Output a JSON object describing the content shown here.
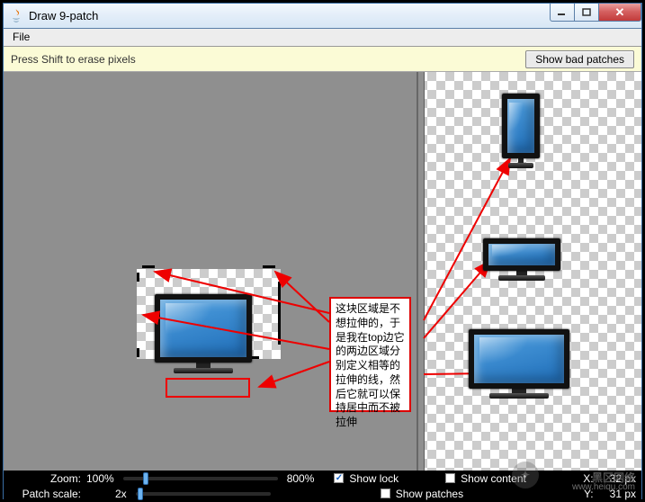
{
  "window": {
    "title": "Draw 9-patch",
    "icons": {
      "app": "java-icon",
      "min": "minimize-icon",
      "max": "maximize-icon",
      "close": "close-icon"
    }
  },
  "menu": {
    "file": "File"
  },
  "toolbar": {
    "hint": "Press Shift to erase pixels",
    "show_bad_patches": "Show bad patches"
  },
  "annotation": {
    "text": "这块区域是不想拉伸的，于是我在top边它的两边区域分别定义相等的拉伸的线，然后它就可以保持居中而不被拉伸"
  },
  "footer": {
    "zoom_label": "Zoom:",
    "zoom_value": "100%",
    "zoom_max": "800%",
    "patch_scale_label": "Patch scale:",
    "patch_scale_value": "2x",
    "show_lock": "Show lock",
    "show_content": "Show content",
    "show_patches": "Show patches",
    "x_label": "X:",
    "x_value": "32 px",
    "y_label": "Y:",
    "y_value": "31 px",
    "show_lock_checked": true,
    "show_content_checked": false,
    "show_patches_checked": false
  },
  "watermark": {
    "main": "黑区网络",
    "sub": "www.heiqu.com"
  }
}
